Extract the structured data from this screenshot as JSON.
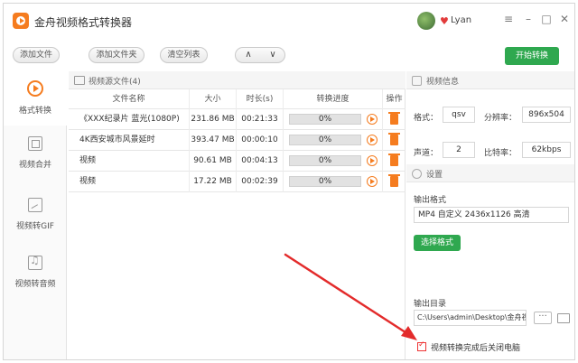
{
  "app": {
    "title": "金舟视频格式转换器",
    "user": "Lyan",
    "win_menu": "≡",
    "win_min": "–",
    "win_max": "□",
    "win_close": "✕"
  },
  "toolbar": {
    "add_file": "添加文件",
    "add_folder": "添加文件夹",
    "clear_list": "清空列表",
    "up": "∧",
    "down": "∨",
    "start": "开始转换"
  },
  "sidebar": {
    "items": [
      {
        "label": "格式转换",
        "icon": "format-convert-icon"
      },
      {
        "label": "视频合并",
        "icon": "video-merge-icon"
      },
      {
        "label": "视频转GIF",
        "icon": "video-gif-icon"
      },
      {
        "label": "视频转音频",
        "icon": "video-audio-icon"
      }
    ]
  },
  "filelist": {
    "title": "视频源文件(4)",
    "headers": [
      "文件名称",
      "大小",
      "时长(s)",
      "转换进度",
      "操作"
    ],
    "rows": [
      {
        "name": "《XXX纪录片 蓝光(1080P)",
        "size": "231.86 MB",
        "duration": "00:21:33",
        "progress_label": "0%",
        "progress": 0
      },
      {
        "name": "4K西安城市风景延时",
        "size": "393.47 MB",
        "duration": "00:00:10",
        "progress_label": "0%",
        "progress": 0
      },
      {
        "name": "视频",
        "size": "90.61 MB",
        "duration": "00:04:13",
        "progress_label": "0%",
        "progress": 0
      },
      {
        "name": "视频",
        "size": "17.22 MB",
        "duration": "00:02:39",
        "progress_label": "0%",
        "progress": 0
      }
    ]
  },
  "video_info": {
    "title": "视频信息",
    "format_label": "格式：",
    "format_value": "qsv",
    "resolution_label": "分辨率：",
    "resolution_value": "896x504",
    "channel_label": "声道：",
    "channel_value": "2",
    "bitrate_label": "比特率：",
    "bitrate_value": "62kbps"
  },
  "settings": {
    "title": "设置",
    "output_format_label": "输出格式",
    "output_format_value": "MP4 自定义 2436x1126 高清",
    "select_format": "选择格式",
    "output_dir_label": "输出目录",
    "output_dir_value": "C:\\Users\\admin\\Desktop\\金舟视",
    "more": "···",
    "shutdown_label": "视频转换完成后关闭电脑",
    "shutdown_checked": true
  },
  "colors": {
    "accent_green": "#2fa84f",
    "accent_orange": "#f57c1f",
    "annotation_red": "#e32b2b"
  }
}
